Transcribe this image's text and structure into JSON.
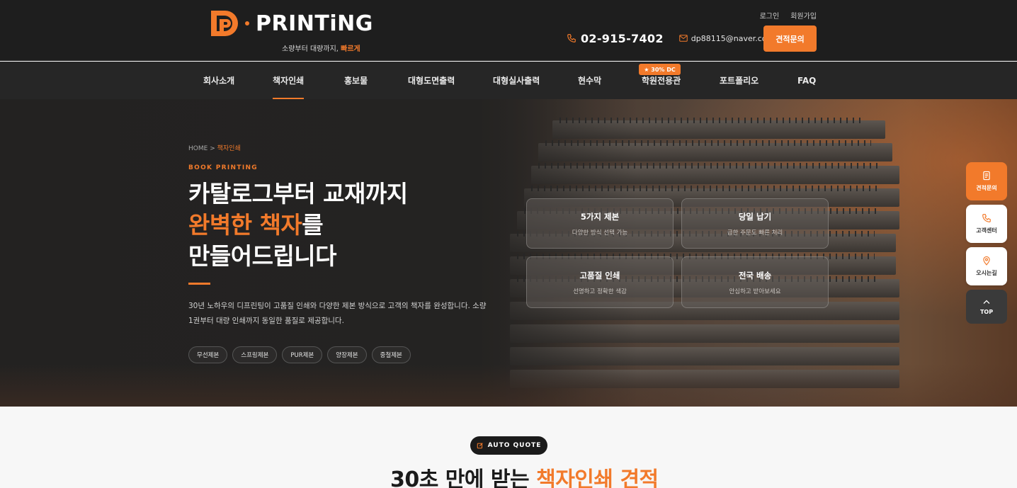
{
  "header": {
    "logo_text": "PRINTiNG",
    "tagline": "소량부터 대량까지, ",
    "tagline_accent": "빠르게",
    "login": "로그인",
    "signup": "회원가입",
    "phone": "02-915-7402",
    "email": "dp88115@naver.com",
    "quote_button": "견적문의"
  },
  "nav": {
    "items": [
      "회사소개",
      "책자인쇄",
      "홍보물",
      "대형도면출력",
      "대형실사출력",
      "현수막",
      "학원전용관",
      "포트폴리오",
      "FAQ"
    ],
    "active": "책자인쇄",
    "badge": "★ 30% DC"
  },
  "hero": {
    "breadcrumb_home": "HOME",
    "breadcrumb_sep": ">",
    "breadcrumb_current": "책자인쇄",
    "eyebrow": "BOOK PRINTING",
    "headline_line1": "카탈로그부터 교재까지",
    "headline_line2_accent": "완벽한 책자",
    "headline_line2_rest": "를",
    "headline_line3": "만들어드립니다",
    "description": "30년 노하우의 디프린팅이 고품질 인쇄와 다양한 제본 방식으로 고객의 책자를 완성합니다. 소량 1권부터 대량 인쇄까지 동일한 품질로 제공합니다.",
    "chips": [
      "무선제본",
      "스프링제본",
      "PUR제본",
      "양장제본",
      "중철제본"
    ],
    "features": [
      {
        "title": "5가지 제본",
        "desc": "다양한 방식 선택 가능"
      },
      {
        "title": "당일 납기",
        "desc": "급한 주문도 빠른 처리"
      },
      {
        "title": "고품질 인쇄",
        "desc": "선명하고 정확한 색감"
      },
      {
        "title": "전국 배송",
        "desc": "안심하고 받아보세요"
      }
    ]
  },
  "side": {
    "quote": "견적문의",
    "call": "고객센터",
    "map": "오시는길",
    "top": "TOP"
  },
  "quote_section": {
    "pill": "AUTO QUOTE",
    "title_pre": "30초 만에 받는 ",
    "title_accent": "책자인쇄 견적"
  },
  "colors": {
    "accent": "#f27a2b",
    "header_bg": "#1e1e1e",
    "nav_bg": "#262626"
  }
}
